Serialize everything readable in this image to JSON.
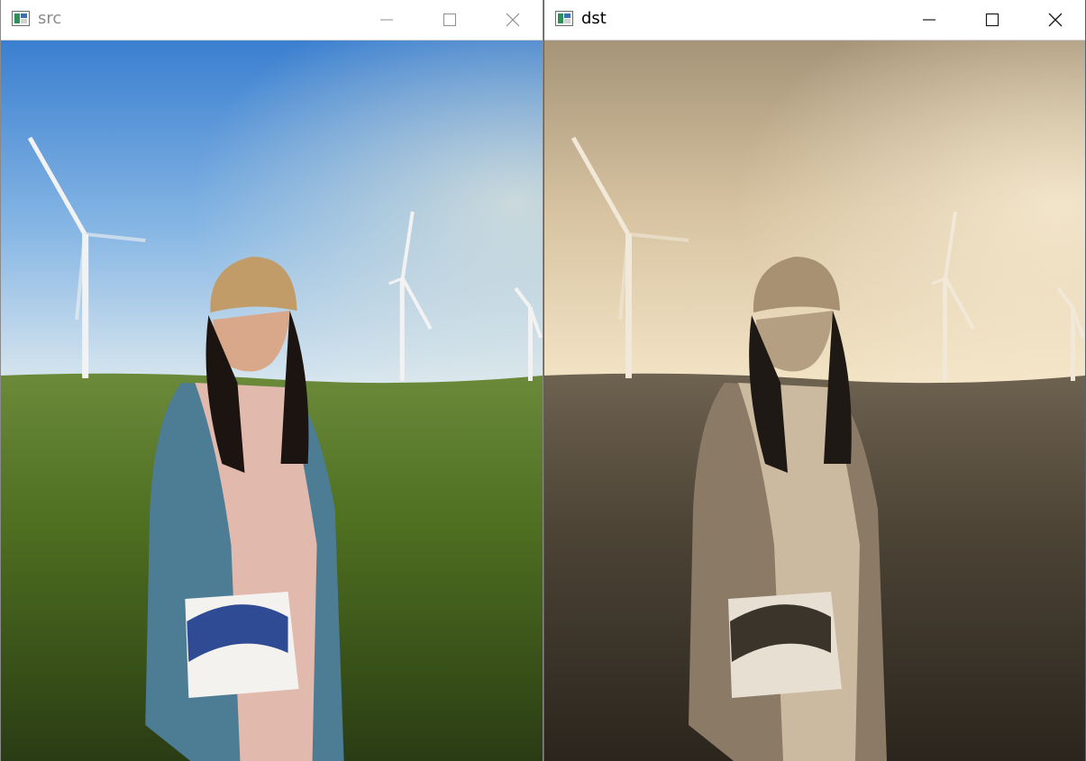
{
  "windows": [
    {
      "title": "src",
      "active": false,
      "image": {
        "subject": "woman-with-cap-and-handbag",
        "filter": "original-color"
      }
    },
    {
      "title": "dst",
      "active": true,
      "image": {
        "subject": "woman-with-cap-and-handbag",
        "filter": "sepia"
      }
    }
  ],
  "controls": {
    "minimize_icon": "minimize-icon",
    "maximize_icon": "maximize-icon",
    "close_icon": "close-icon"
  },
  "colors": {
    "sky_top": "#3f86d2",
    "sky_bottom": "#c9dff0",
    "grass": "#4d6a1e",
    "sepia_light": "#efd9b4",
    "sepia_dark": "#3a3026"
  }
}
